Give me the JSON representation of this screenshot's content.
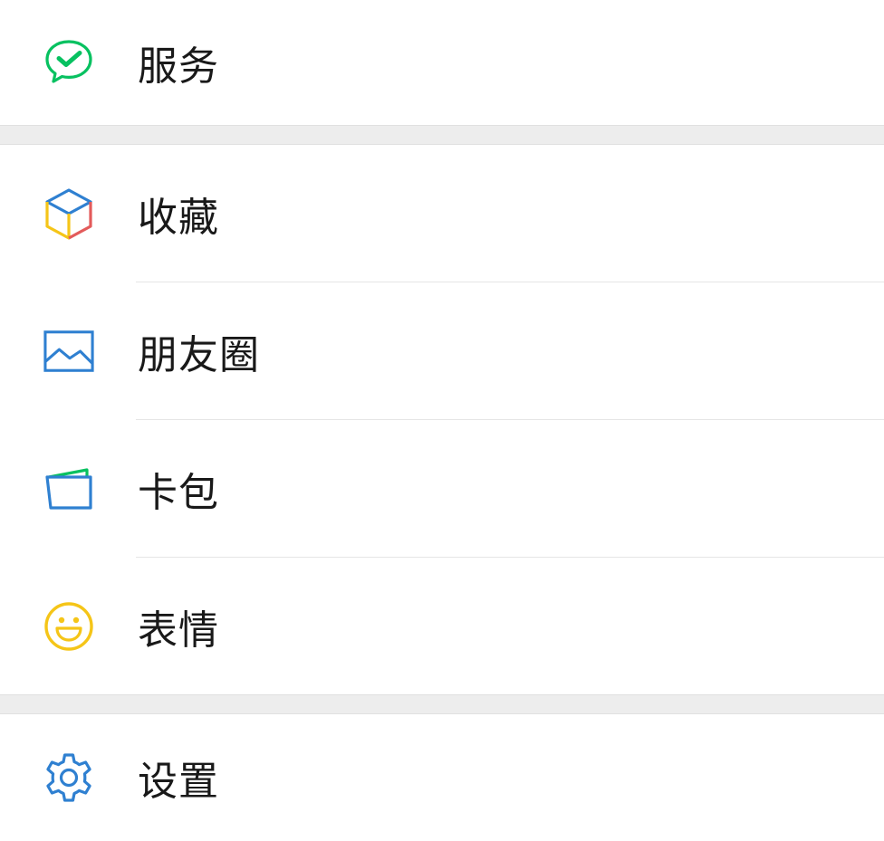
{
  "menu": {
    "services": {
      "label": "服务",
      "icon": "wechat-pay-icon"
    },
    "favorites": {
      "label": "收藏",
      "icon": "cube-icon"
    },
    "moments": {
      "label": "朋友圈",
      "icon": "image-icon"
    },
    "cards": {
      "label": "卡包",
      "icon": "wallet-icon"
    },
    "stickers": {
      "label": "表情",
      "icon": "smiley-icon"
    },
    "settings": {
      "label": "设置",
      "icon": "gear-icon"
    }
  },
  "colors": {
    "green": "#07c160",
    "blue": "#2f80d1",
    "yellow": "#f5c518",
    "red": "#e35b5b",
    "background": "#ededed"
  }
}
